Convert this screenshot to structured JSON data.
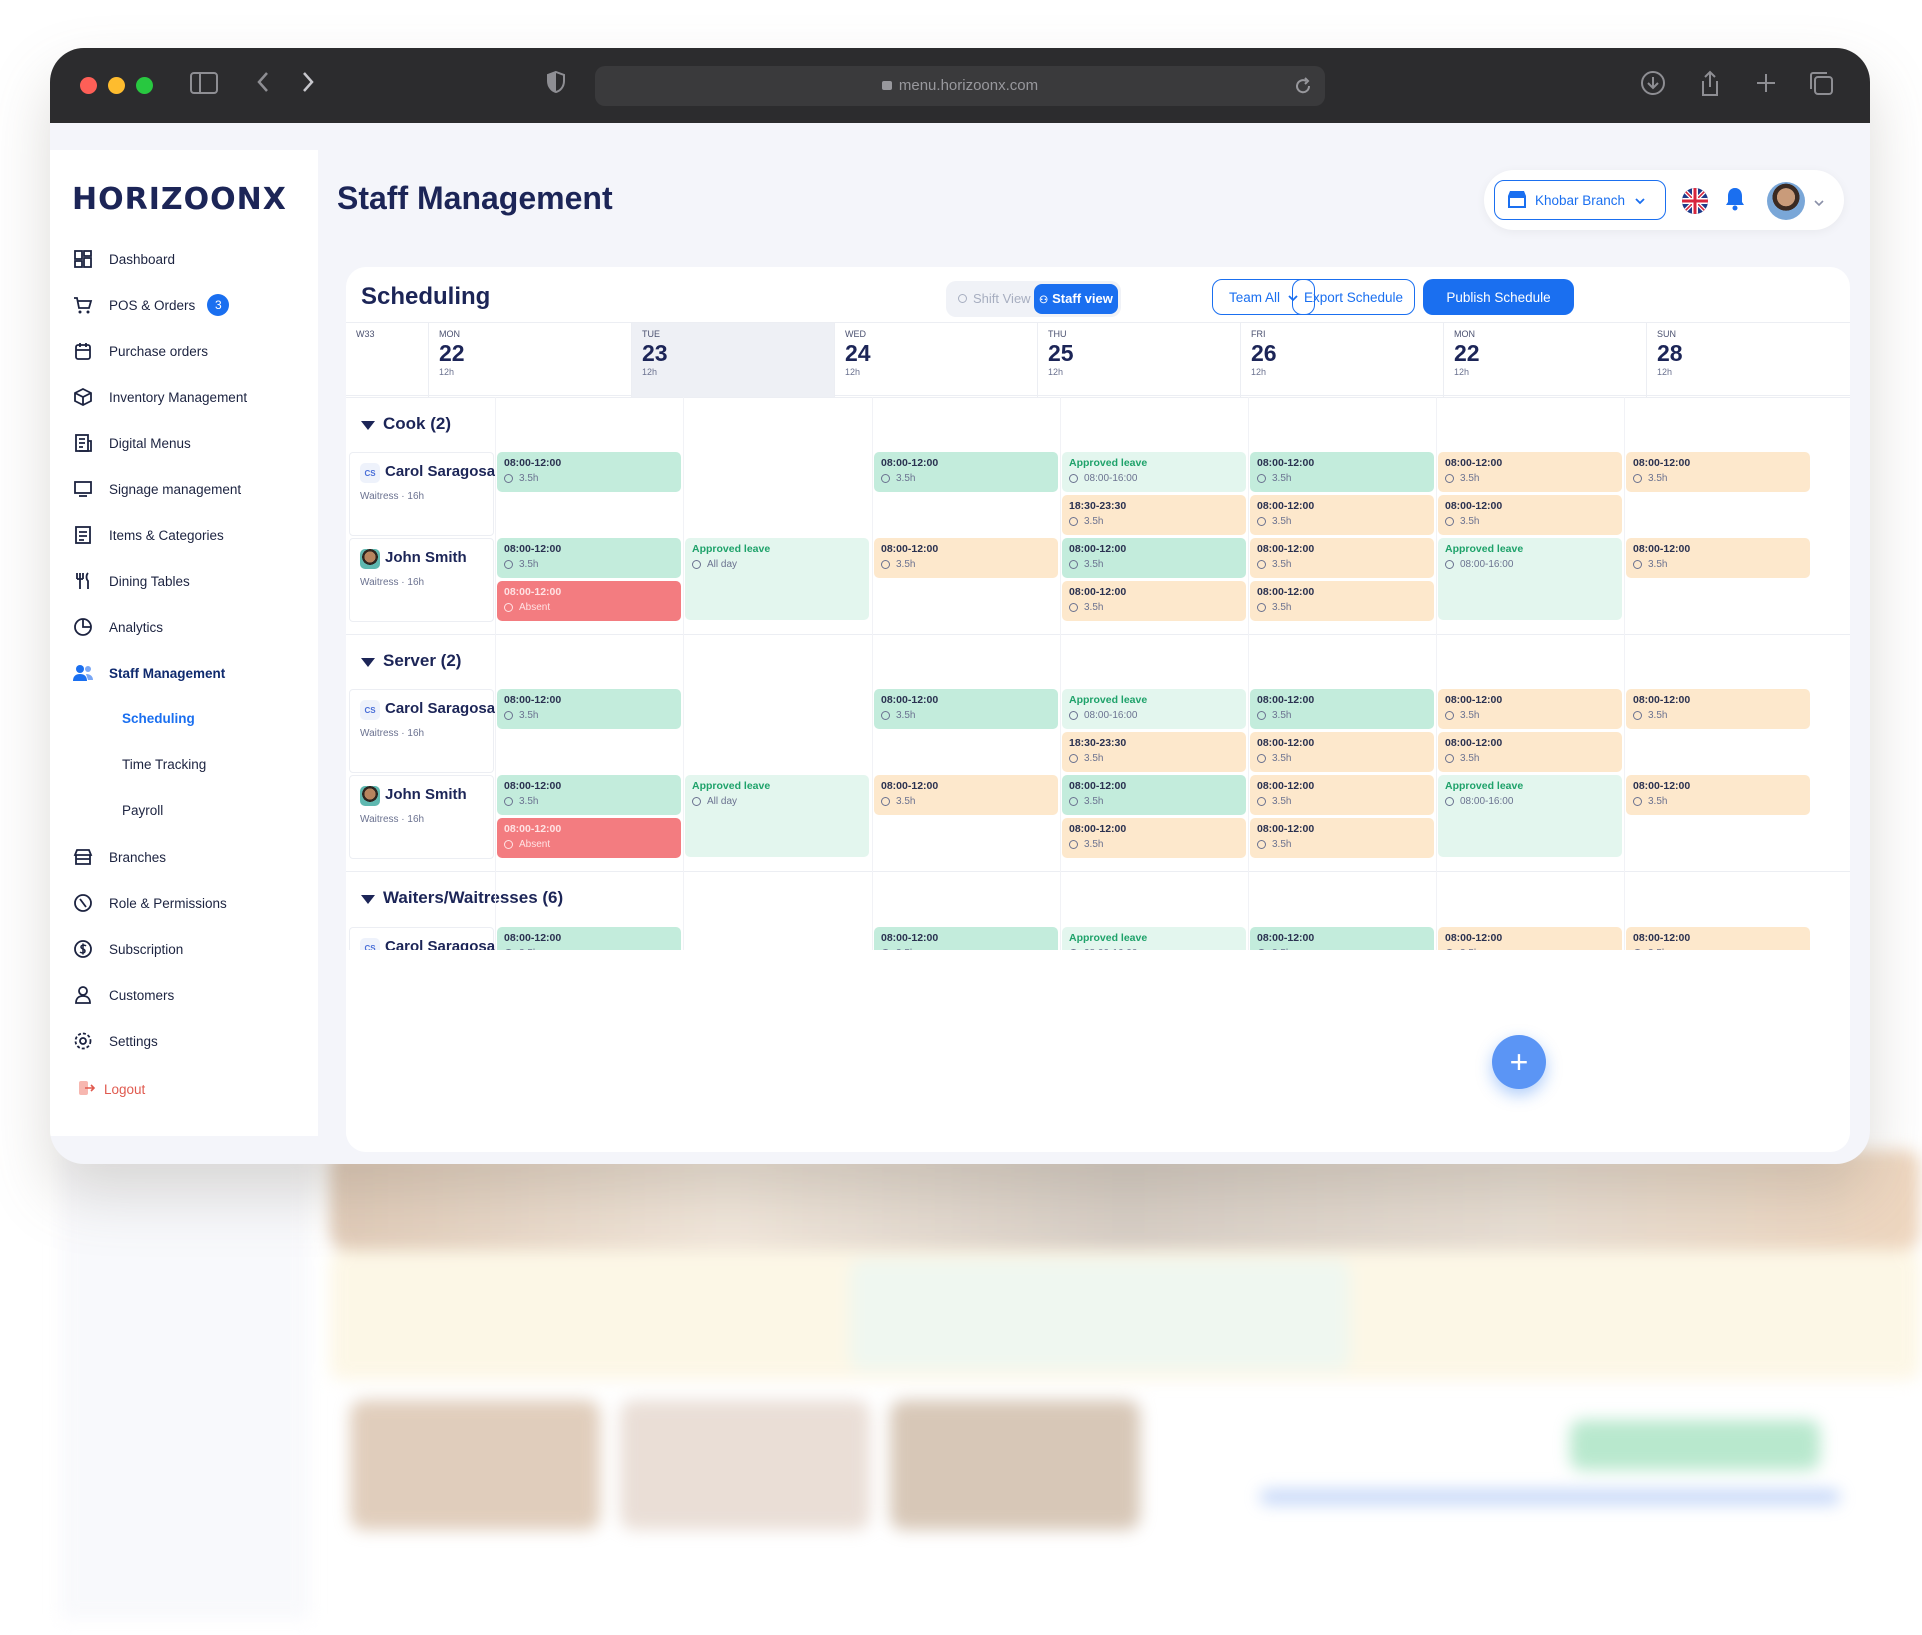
{
  "browser": {
    "url": "menu.horizoonx.com"
  },
  "brand": {
    "logo": "HORIZOONX"
  },
  "sidebar": {
    "items": [
      {
        "label": "Dashboard",
        "icon": "dashboard-icon"
      },
      {
        "label": "POS & Orders",
        "icon": "cart-icon",
        "badge": "3"
      },
      {
        "label": "Purchase orders",
        "icon": "purchase-icon"
      },
      {
        "label": "Inventory Management",
        "icon": "box-icon"
      },
      {
        "label": "Digital Menus",
        "icon": "menu-icon"
      },
      {
        "label": "Signage management",
        "icon": "monitor-icon"
      },
      {
        "label": "Items & Categories",
        "icon": "list-icon"
      },
      {
        "label": "Dining Tables",
        "icon": "cutlery-icon"
      },
      {
        "label": "Analytics",
        "icon": "pie-icon"
      },
      {
        "label": "Staff Management",
        "icon": "users-icon"
      },
      {
        "label": "Branches",
        "icon": "store-icon"
      },
      {
        "label": "Role & Permissions",
        "icon": "compass-icon"
      },
      {
        "label": "Subscription",
        "icon": "dollar-icon"
      },
      {
        "label": "Customers",
        "icon": "user-icon"
      },
      {
        "label": "Settings",
        "icon": "gear-icon"
      }
    ],
    "sub_items": [
      "Scheduling",
      "Time Tracking",
      "Payroll"
    ],
    "logout": "Logout"
  },
  "header": {
    "title": "Staff Management",
    "branch": "Khobar Branch"
  },
  "scheduling": {
    "title": "Scheduling",
    "shift_view": "Shift View",
    "staff_view": "Staff view",
    "team": "Team All",
    "export": "Export Schedule",
    "publish": "Publish Schedule",
    "week": "W33",
    "days": [
      {
        "dow": "MON",
        "num": "22",
        "hrs": "12h"
      },
      {
        "dow": "TUE",
        "num": "23",
        "hrs": "12h"
      },
      {
        "dow": "WED",
        "num": "24",
        "hrs": "12h"
      },
      {
        "dow": "THU",
        "num": "25",
        "hrs": "12h"
      },
      {
        "dow": "FRI",
        "num": "26",
        "hrs": "12h"
      },
      {
        "dow": "MON",
        "num": "22",
        "hrs": "12h"
      },
      {
        "dow": "SUN",
        "num": "28",
        "hrs": "12h"
      }
    ],
    "groups": [
      {
        "title": "Cook (2)"
      },
      {
        "title": "Server (2)"
      },
      {
        "title": "Waiters/Waitresses (6)"
      }
    ],
    "staff": {
      "carol": {
        "name": "Carol Saragosa",
        "role": "Waitress · 16h",
        "initials": "CS"
      },
      "john": {
        "name": "John Smith",
        "role": "Waitress · 16h"
      }
    },
    "shift": {
      "time_a": "08:00-12:00",
      "time_b": "18:30-23:30",
      "hours": "3.5h",
      "leave": "Approved leave",
      "leave_time": "08:00-16:00",
      "all_day": "All day",
      "absent": "Absent"
    }
  },
  "colors": {
    "primary": "#1a6ff0",
    "shift_green": "#c3ecdc",
    "shift_orange": "#fde8cc",
    "leave": "#e3f6ee",
    "absent": "#f37c80"
  }
}
